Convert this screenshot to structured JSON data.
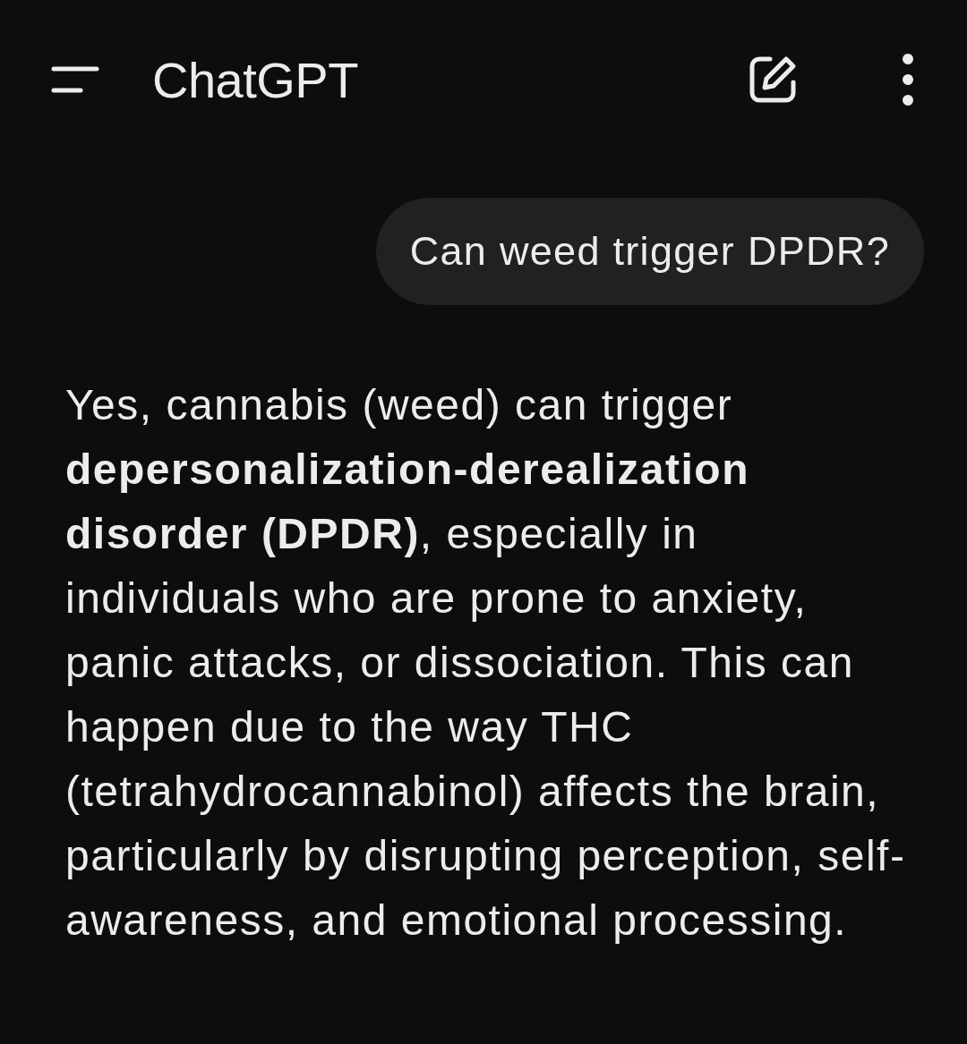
{
  "header": {
    "title": "ChatGPT"
  },
  "messages": [
    {
      "kind": "user",
      "text": "Can weed trigger DPDR?"
    },
    {
      "kind": "assistant",
      "text": "Yes, cannabis (weed) can trigger **depersonalization-derealization disorder (DPDR)**, especially in individuals who are prone to anxiety, panic attacks, or dissociation. This can happen due to the way THC (tetrahydrocannabinol) affects the brain, particularly by disrupting perception, self-awareness, and emotional processing."
    }
  ]
}
